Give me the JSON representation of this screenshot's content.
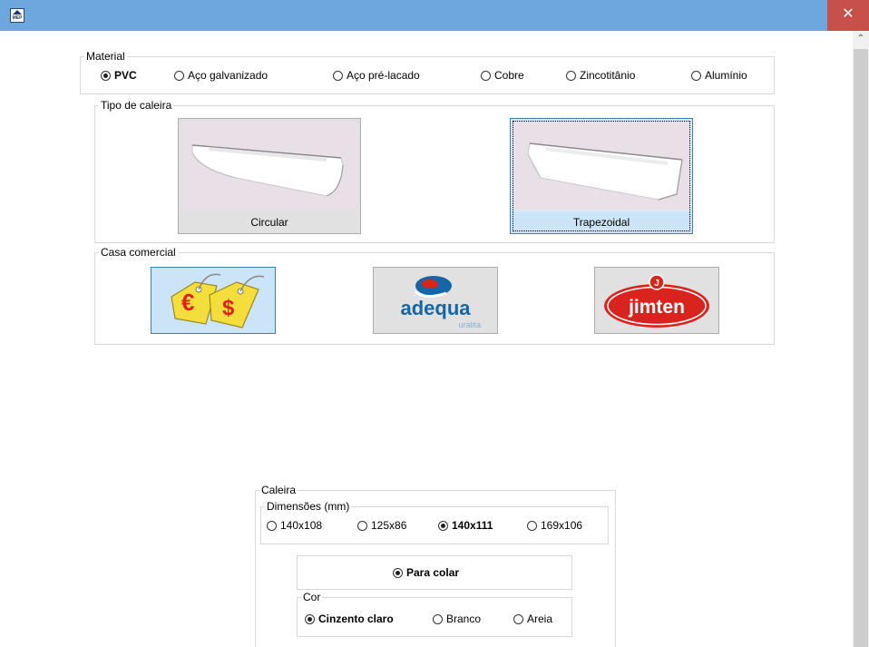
{
  "window": {
    "app_icon_text": "MEP",
    "close_icon": "close-icon"
  },
  "material": {
    "legend": "Material",
    "options": [
      {
        "label": "PVC",
        "selected": true
      },
      {
        "label": "Aço galvanizado",
        "selected": false
      },
      {
        "label": "Aço pré-lacado",
        "selected": false
      },
      {
        "label": "Cobre",
        "selected": false
      },
      {
        "label": "Zincotitânio",
        "selected": false
      },
      {
        "label": "Alumínio",
        "selected": false
      }
    ]
  },
  "tipo_caleira": {
    "legend": "Tipo de caleira",
    "options": [
      {
        "label": "Circular",
        "selected": false
      },
      {
        "label": "Trapezoidal",
        "selected": true
      }
    ]
  },
  "casa_comercial": {
    "legend": "Casa comercial",
    "brands": [
      {
        "name": "generic-price-tags",
        "icon": "price-tags-icon",
        "selected": true
      },
      {
        "name": "adequa",
        "label": "adequa",
        "sublabel": "uralita",
        "selected": false
      },
      {
        "name": "jimten",
        "label": "jimten",
        "selected": false
      }
    ],
    "colors": {
      "tag_yellow": "#f5e04a",
      "symbol_red": "#e0201a",
      "adequa_blue": "#1466a6",
      "jimten_red": "#d8231f"
    }
  },
  "caleira": {
    "legend": "Caleira",
    "dimensoes": {
      "legend": "Dimensões (mm)",
      "options": [
        {
          "label": "140x108",
          "selected": false
        },
        {
          "label": "125x86",
          "selected": false
        },
        {
          "label": "140x111",
          "selected": true
        },
        {
          "label": "169x106",
          "selected": false
        }
      ]
    },
    "para_colar": {
      "label": "Para colar",
      "selected": true
    },
    "cor": {
      "legend": "Cor",
      "options": [
        {
          "label": "Cinzento claro",
          "selected": true
        },
        {
          "label": "Branco",
          "selected": false
        },
        {
          "label": "Areia",
          "selected": false
        }
      ]
    }
  }
}
